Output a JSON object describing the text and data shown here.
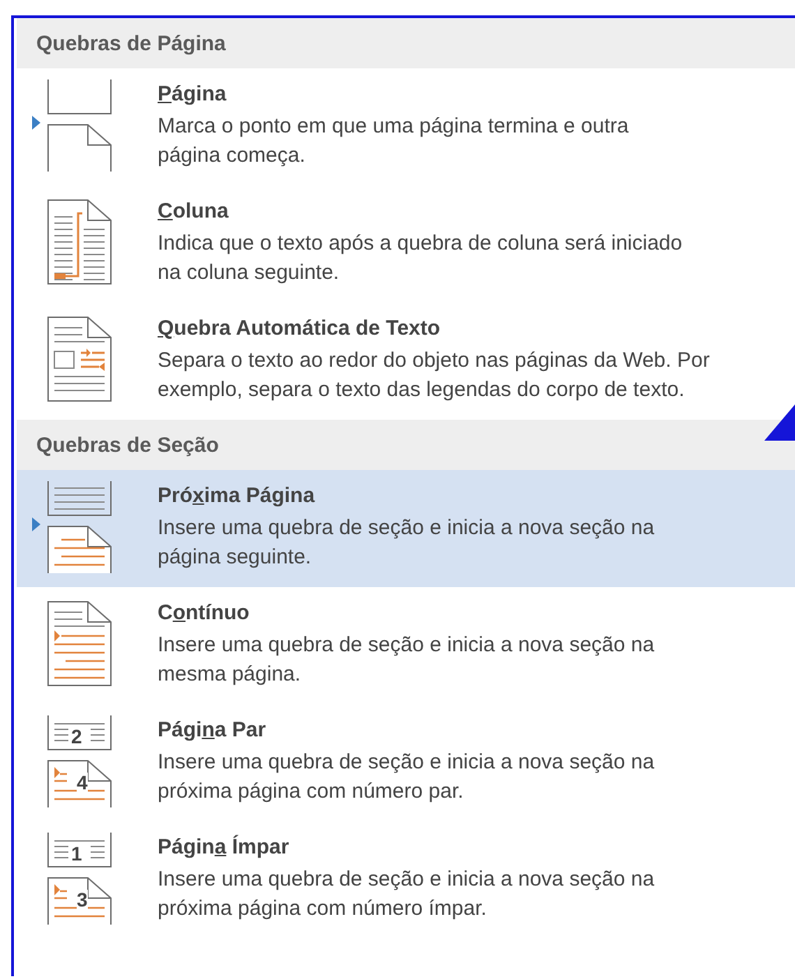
{
  "sections": [
    {
      "title": "Quebras de Página",
      "items": [
        {
          "kind": "page",
          "selected": false,
          "pointer": true,
          "label": [
            {
              "text": "P",
              "access_key": true
            },
            {
              "text": "ágina",
              "access_key": false
            }
          ],
          "description": [
            "Marca o ponto em que uma página termina e outra",
            "página começa."
          ]
        },
        {
          "kind": "column",
          "selected": false,
          "pointer": false,
          "label": [
            {
              "text": "C",
              "access_key": true
            },
            {
              "text": "oluna",
              "access_key": false
            }
          ],
          "description": [
            "Indica que o texto após a quebra de coluna será iniciado",
            "na coluna seguinte."
          ]
        },
        {
          "kind": "wrap",
          "selected": false,
          "pointer": false,
          "label": [
            {
              "text": "Q",
              "access_key": true
            },
            {
              "text": "uebra Automática de Texto",
              "access_key": false
            }
          ],
          "description": [
            "Separa o texto ao redor do objeto nas páginas da Web. Por",
            "exemplo, separa o texto das legendas do corpo de texto."
          ]
        }
      ]
    },
    {
      "title": "Quebras de Seção",
      "items": [
        {
          "kind": "next",
          "selected": true,
          "pointer": true,
          "label": [
            {
              "text": "Pró",
              "access_key": false
            },
            {
              "text": "x",
              "access_key": true
            },
            {
              "text": "ima Página",
              "access_key": false
            }
          ],
          "description": [
            "Insere uma quebra de seção e inicia a nova seção na",
            "página seguinte."
          ]
        },
        {
          "kind": "continuous",
          "selected": false,
          "pointer": false,
          "label": [
            {
              "text": "C",
              "access_key": false
            },
            {
              "text": "o",
              "access_key": true
            },
            {
              "text": "ntínuo",
              "access_key": false
            }
          ],
          "description": [
            "Insere uma quebra de seção e inicia a nova seção na",
            "mesma página."
          ]
        },
        {
          "kind": "numbered",
          "selected": false,
          "pointer": false,
          "icon_numbers": [
            "2",
            "4"
          ],
          "label": [
            {
              "text": "Pági",
              "access_key": false
            },
            {
              "text": "n",
              "access_key": true
            },
            {
              "text": "a Par",
              "access_key": false
            }
          ],
          "description": [
            "Insere uma quebra de seção e inicia a nova seção na",
            "próxima página com número par."
          ]
        },
        {
          "kind": "numbered",
          "selected": false,
          "pointer": false,
          "icon_numbers": [
            "1",
            "3"
          ],
          "label": [
            {
              "text": "Págin",
              "access_key": false
            },
            {
              "text": "a",
              "access_key": true
            },
            {
              "text": " Ímpar",
              "access_key": false
            }
          ],
          "description": [
            "Insere uma quebra de seção e inicia a nova seção na",
            "próxima página com número ímpar."
          ]
        }
      ]
    }
  ]
}
